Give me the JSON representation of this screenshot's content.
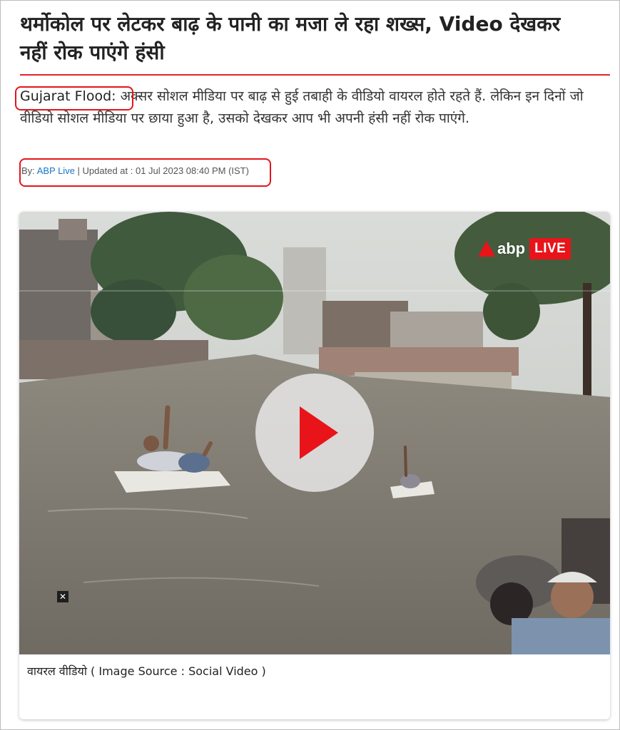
{
  "article": {
    "headline": "थर्मोकोल पर लेटकर बाढ़ के पानी का मजा ले रहा शख्स, Video देखकर नहीं रोक पाएंगे हंसी",
    "lead_tag": "Gujarat Flood:",
    "lead_text": " अक्सर सोशल मीडिया पर बाढ़ से हुई तबाही के वीडियो वायरल होते रहते हैं. लेकिन इन दिनों जो वीडियो सोशल मीडिया पर छाया हुआ है, उसको देखकर आप भी अपनी हंसी नहीं रोक पाएंगे.",
    "byline_prefix": "By: ",
    "author": "ABP Live",
    "updated": " | Updated at : 01 Jul 2023 08:40 PM (IST)"
  },
  "media": {
    "logo_text": "abp",
    "live_label": "LIVE",
    "close_label": "✕",
    "caption": "वायरल वीडियो ( Image Source : Social Video )"
  },
  "icons": {
    "play": "play-icon",
    "close": "close-icon"
  },
  "colors": {
    "accent_red": "#e0242b",
    "highlight_box": "#e3161c",
    "author_link": "#1a73c8",
    "play_triangle": "#e8141a"
  }
}
